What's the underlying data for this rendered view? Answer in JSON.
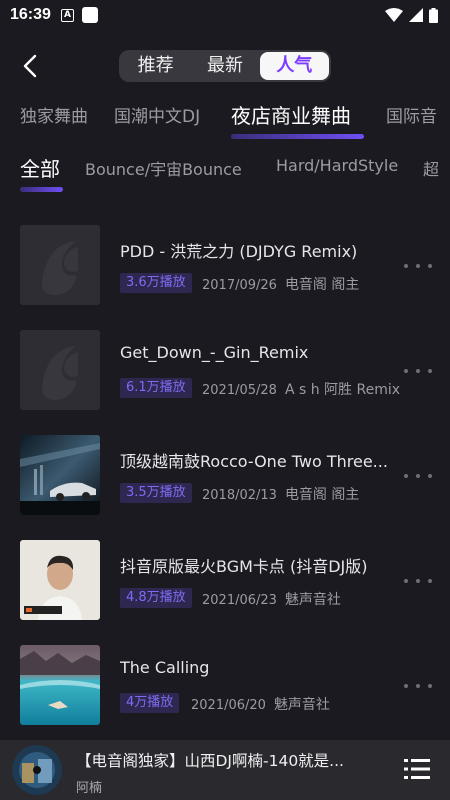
{
  "status_bar": {
    "time": "16:39",
    "notif_badge": "A"
  },
  "header": {
    "segments": [
      "推荐",
      "最新",
      "人气"
    ],
    "active_segment": "人气"
  },
  "categories": [
    "独家舞曲",
    "国潮中文DJ",
    "夜店商业舞曲",
    "国际音"
  ],
  "active_category": "夜店商业舞曲",
  "subcategories": [
    "全部",
    "Bounce/宇宙Bounce",
    "Hard/HardStyle",
    "超"
  ],
  "active_subcategory": "全部",
  "songs": [
    {
      "title": "PDD - 洪荒之力 (DJDYG Remix)",
      "plays": "3.6万播放",
      "date": "2017/09/26",
      "author": "电音阁 阁主",
      "cover": "placeholder-logo"
    },
    {
      "title": "Get_Down_-_Gin_Remix",
      "plays": "6.1万播放",
      "date": "2021/05/28",
      "author": "A s h 阿胜 Remix",
      "cover": "placeholder-logo"
    },
    {
      "title": "顶级越南鼓Rocco-One Two Three...",
      "plays": "3.5万播放",
      "date": "2018/02/13",
      "author": "电音阁 阁主",
      "cover": "car-photo"
    },
    {
      "title": "抖音原版最火BGM卡点 (抖音DJ版)",
      "plays": "4.8万播放",
      "date": "2021/06/23",
      "author": "魅声音社",
      "cover": "portrait-photo"
    },
    {
      "title": "The Calling",
      "plays": "4万播放",
      "date": "2021/06/20",
      "author": "魅声音社",
      "cover": "ocean-photo"
    }
  ],
  "player": {
    "title": "【电音阁独家】山西DJ啊楠-140就是...",
    "artist": "阿楠"
  },
  "colors": {
    "accent": "#7d3cff",
    "background": "#1b1a20",
    "badge_bg": "#2e2850",
    "badge_text": "#7d6bf2"
  }
}
